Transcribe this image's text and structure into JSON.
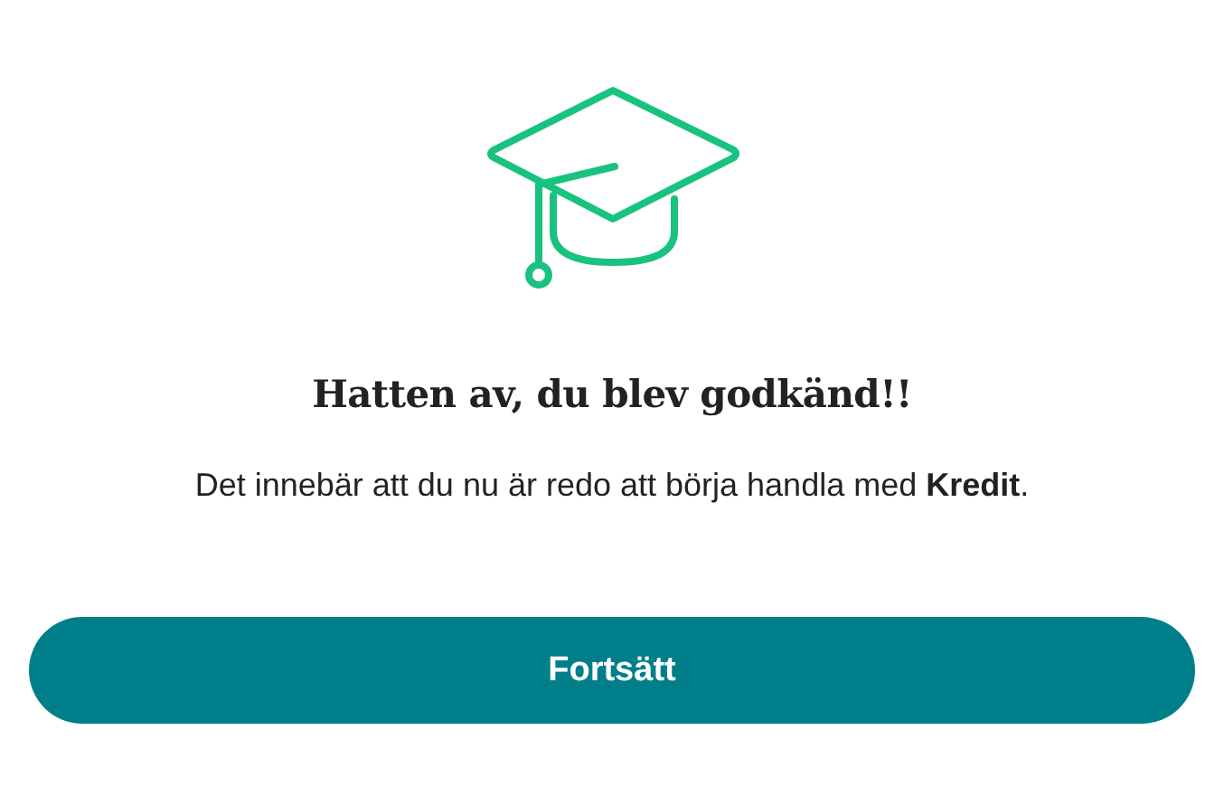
{
  "heading": "Hatten av, du blev godkänd!!",
  "message": "Det innebär att du nu är redo att börja handla med **Kredit**.",
  "buttons": [
    "Fortsätt"
  ]
}
